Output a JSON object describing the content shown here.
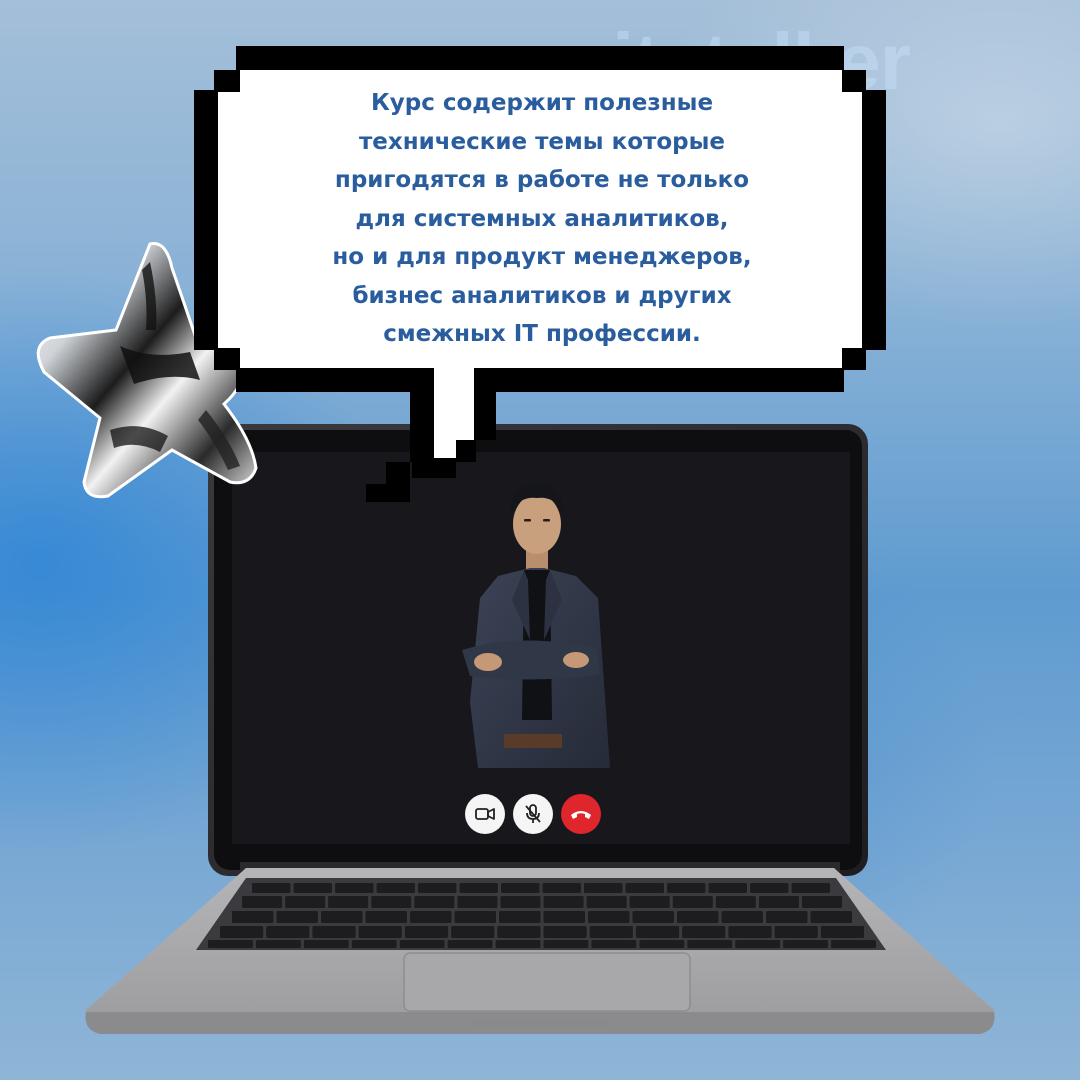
{
  "watermark": {
    "text": "itstalker"
  },
  "speech_bubble": {
    "lines": [
      "Курс содержит полезные",
      "технические темы которые",
      "пригодятся в работе не только",
      "для системных аналитиков,",
      "но и для продукт менеджеров,",
      "бизнес аналитиков и других",
      "смежных IT профессии."
    ]
  },
  "video_call": {
    "controls": [
      {
        "name": "camera-button",
        "icon": "video-camera-icon"
      },
      {
        "name": "mute-button",
        "icon": "microphone-off-icon"
      },
      {
        "name": "end-call-button",
        "icon": "phone-hangup-icon"
      }
    ]
  },
  "colors": {
    "text_accent": "#2a5d9e",
    "end_call": "#e0262d",
    "screen": "#17171c"
  }
}
